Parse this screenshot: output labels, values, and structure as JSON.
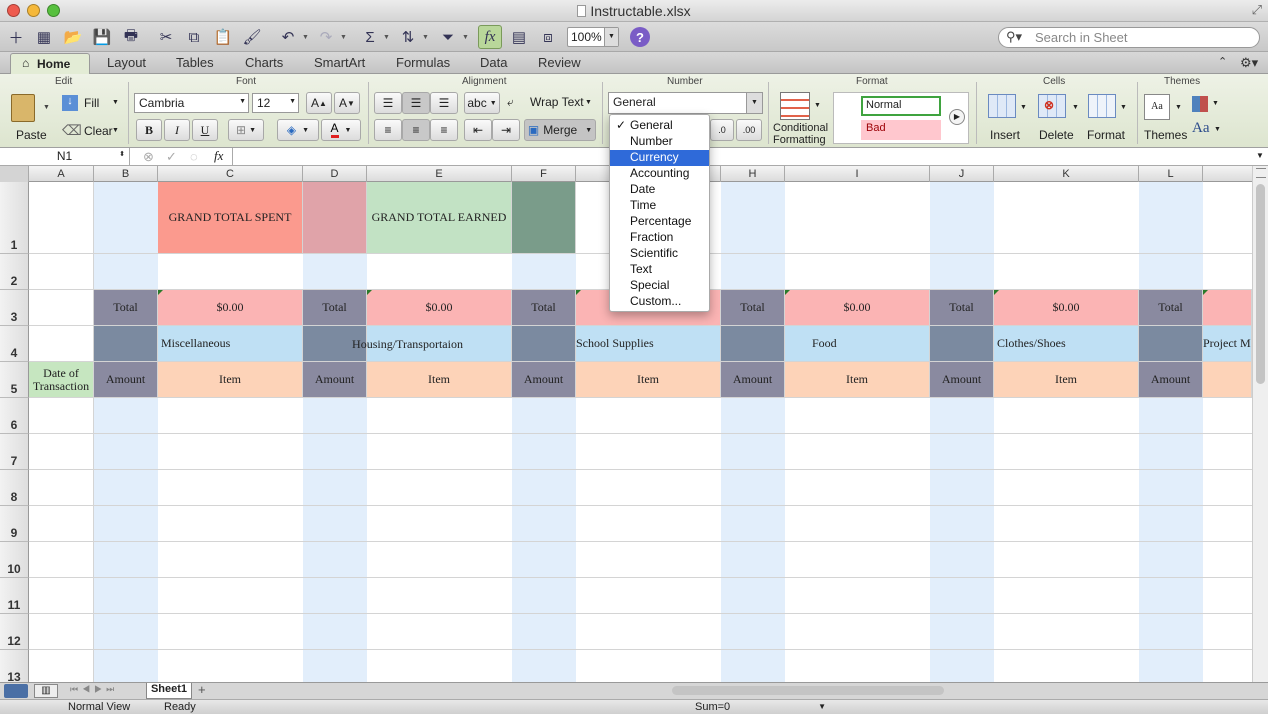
{
  "window": {
    "title": "Instructable.xlsx"
  },
  "toolbar": {
    "zoom": "100%",
    "search_placeholder": "Search in Sheet"
  },
  "ribbon_tabs": [
    "Home",
    "Layout",
    "Tables",
    "Charts",
    "SmartArt",
    "Formulas",
    "Data",
    "Review"
  ],
  "ribbon": {
    "groups": {
      "edit": "Edit",
      "font": "Font",
      "alignment": "Alignment",
      "number": "Number",
      "format": "Format",
      "cells": "Cells",
      "themes": "Themes"
    },
    "edit": {
      "paste": "Paste",
      "fill": "Fill",
      "clear": "Clear"
    },
    "font": {
      "name": "Cambria",
      "size": "12",
      "bold": "B",
      "italic": "I",
      "underline": "U"
    },
    "alignment": {
      "wrap": "Wrap Text",
      "merge": "Merge",
      "abc": "abc"
    },
    "number": {
      "format_value": "General",
      "dec_inc": ".0",
      "dec_dec": ".00"
    },
    "format": {
      "conditional": "Conditional",
      "formatting": "Formatting",
      "style_normal": "Normal",
      "style_bad": "Bad"
    },
    "cells": {
      "insert": "Insert",
      "delete": "Delete",
      "format": "Format"
    },
    "themes": {
      "themes": "Themes",
      "aa": "Aa"
    }
  },
  "formula_bar": {
    "cell_ref": "N1",
    "fx": "fx",
    "content": ""
  },
  "columns": [
    "A",
    "B",
    "C",
    "D",
    "E",
    "F",
    "G",
    "H",
    "I",
    "J",
    "K",
    "L"
  ],
  "rows": [
    "1",
    "2",
    "3",
    "4",
    "5",
    "6",
    "7",
    "8",
    "9",
    "10",
    "11",
    "12",
    "13"
  ],
  "cells": {
    "c1": "GRAND TOTAL SPENT",
    "e1": "GRAND TOTAL EARNED",
    "b3": "Total",
    "c3": "$0.00",
    "d3": "Total",
    "e3": "$0.00",
    "f3": "Total",
    "h3": "Total",
    "i3": "$0.00",
    "j3": "Total",
    "k3": "$0.00",
    "l3": "Total",
    "c4": "Miscellaneous",
    "d4": "Housing/Transportaion",
    "g4": "School Supplies",
    "i4": "Food",
    "k4": "Clothes/Shoes",
    "m4": "Project Ma",
    "a5": "Date of Transaction",
    "b5": "Amount",
    "c5": "Item",
    "d5": "Amount",
    "e5": "Item",
    "f5": "Amount",
    "g5": "Item",
    "h5": "Amount",
    "i5": "Item",
    "j5": "Amount",
    "k5": "Item",
    "l5": "Amount"
  },
  "number_format_menu": {
    "items": [
      "General",
      "Number",
      "Currency",
      "Accounting",
      "Date",
      "Time",
      "Percentage",
      "Fraction",
      "Scientific",
      "Text",
      "Special",
      "Custom..."
    ],
    "checked": "General",
    "highlighted": "Currency"
  },
  "sheet_tabs": [
    "Sheet1"
  ],
  "status": {
    "view": "Normal View",
    "state": "Ready",
    "sum": "Sum=0"
  },
  "colors": {
    "spent_red": "#fb9a8e",
    "spent_dark": "#e0a3a9",
    "earned_green": "#c2e2c4",
    "earned_dark": "#7a9c8a",
    "total_slate": "#8a8aa0",
    "total_pink": "#fbb4b4",
    "category_blue": "#bfe0f4",
    "item_peach": "#fdd3b8",
    "amount_col_bg": "#e2eefb",
    "date_green": "#c6e6c0",
    "menu_highlight": "#2f6ad9"
  }
}
